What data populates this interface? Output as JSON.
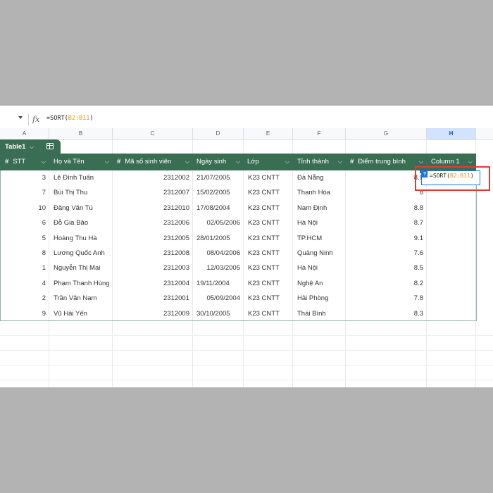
{
  "formula_bar": {
    "fx_label": "fx",
    "formula_prefix": "=SORT(",
    "formula_ref": "B2:B11",
    "formula_suffix": ")"
  },
  "columns": [
    "A",
    "B",
    "C",
    "D",
    "E",
    "F",
    "G",
    "H"
  ],
  "selected_column": "H",
  "table": {
    "name": "Table1",
    "headers": [
      "STT",
      "Họ và Tên",
      "Mã số sinh viên",
      "Ngày sinh",
      "Lớp",
      "Tỉnh thành",
      "Điểm trung bình",
      "Column 1"
    ],
    "rows": [
      {
        "stt": "3",
        "name": "Lê Đình Tuấn",
        "id": "2312002",
        "dob": "21/07/2005",
        "class": "K23 CNTT",
        "city": "Đà Nẵng",
        "score": "8.9"
      },
      {
        "stt": "7",
        "name": "Bùi Thị Thu",
        "id": "2312007",
        "dob": "15/02/2005",
        "class": "K23 CNTT",
        "city": "Thanh Hóa",
        "score": "8"
      },
      {
        "stt": "10",
        "name": "Đặng Văn Tú",
        "id": "2312010",
        "dob": "17/08/2004",
        "class": "K23 CNTT",
        "city": "Nam Định",
        "score": "8.8"
      },
      {
        "stt": "6",
        "name": "Đỗ Gia Bảo",
        "id": "2312006",
        "dob": "02/05/2006",
        "class": "K23 CNTT",
        "city": "Hà Nội",
        "score": "8.7"
      },
      {
        "stt": "5",
        "name": "Hoàng Thu Hà",
        "id": "2312005",
        "dob": "28/01/2005",
        "class": "K23 CNTT",
        "city": "TP.HCM",
        "score": "9.1"
      },
      {
        "stt": "8",
        "name": "Lương Quốc Anh",
        "id": "2312008",
        "dob": "08/04/2006",
        "class": "K23 CNTT",
        "city": "Quảng Ninh",
        "score": "7.6"
      },
      {
        "stt": "1",
        "name": "Nguyễn Thị Mai",
        "id": "2312003",
        "dob": "12/03/2005",
        "class": "K23 CNTT",
        "city": "Hà Nội",
        "score": "8.5"
      },
      {
        "stt": "4",
        "name": "Phạm Thanh Hùng",
        "id": "2312004",
        "dob": "19/11/2004",
        "class": "K23 CNTT",
        "city": "Nghệ An",
        "score": "8.2"
      },
      {
        "stt": "2",
        "name": "Trần Văn Nam",
        "id": "2312001",
        "dob": "05/09/2004",
        "class": "K23 CNTT",
        "city": "Hải Phòng",
        "score": "7.8"
      },
      {
        "stt": "9",
        "name": "Vũ Hải Yến",
        "id": "2312009",
        "dob": "30/10/2005",
        "class": "K23 CNTT",
        "city": "Thái Bình",
        "score": "8.3"
      }
    ]
  },
  "edit_cell": {
    "badge": "?",
    "prefix": "=SORT(",
    "ref": "B2:B11",
    "suffix": ")"
  },
  "colors": {
    "table_header": "#3a6e52",
    "highlight": "#e53935",
    "edit_border": "#1a73e8",
    "ref": "#e69b00"
  }
}
